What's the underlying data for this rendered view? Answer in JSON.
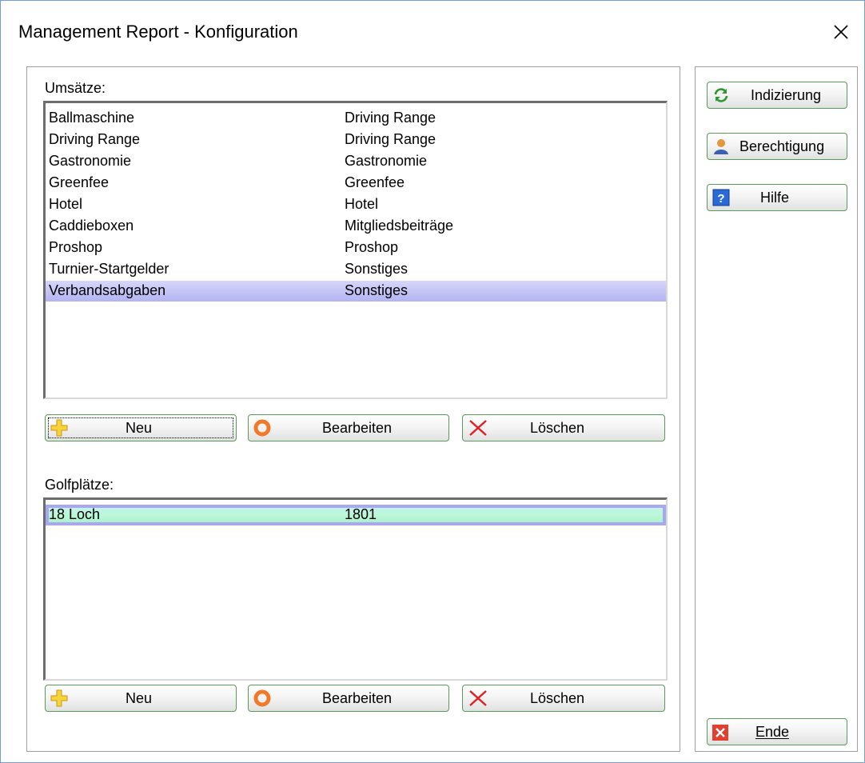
{
  "window": {
    "title": "Management Report - Konfiguration"
  },
  "umsaetze": {
    "label": "Umsätze:",
    "rows": [
      {
        "name": "Ballmaschine",
        "category": "Driving Range"
      },
      {
        "name": "Driving Range",
        "category": "Driving Range"
      },
      {
        "name": "Gastronomie",
        "category": "Gastronomie"
      },
      {
        "name": "Greenfee",
        "category": "Greenfee"
      },
      {
        "name": "Hotel",
        "category": "Hotel"
      },
      {
        "name": "Caddieboxen",
        "category": "Mitgliedsbeiträge"
      },
      {
        "name": "Proshop",
        "category": "Proshop"
      },
      {
        "name": "Turnier-Startgelder",
        "category": "Sonstiges"
      },
      {
        "name": "Verbandsabgaben",
        "category": "Sonstiges"
      }
    ],
    "selected_index": 8,
    "buttons": {
      "new": "Neu",
      "edit": "Bearbeiten",
      "delete": "Löschen"
    }
  },
  "golfplaetze": {
    "label": "Golfplätze:",
    "rows": [
      {
        "name": "18 Loch",
        "code": "1801"
      }
    ],
    "buttons": {
      "new": "Neu",
      "edit": "Bearbeiten",
      "delete": "Löschen"
    }
  },
  "sidebar": {
    "indexing": "Indizierung",
    "permission": "Berechtigung",
    "help": "Hilfe",
    "end": "Ende"
  },
  "icons": {
    "close": "close-icon",
    "new": "plus-icon",
    "edit": "lifebuoy-icon",
    "delete": "x-icon",
    "indexing": "refresh-icon",
    "permission": "user-icon",
    "help": "help-icon",
    "end": "exit-icon"
  },
  "colors": {
    "selected_row": "#c0c0f4",
    "focused_row": "#b8f6d4",
    "button_border": "#5a9a5a"
  }
}
